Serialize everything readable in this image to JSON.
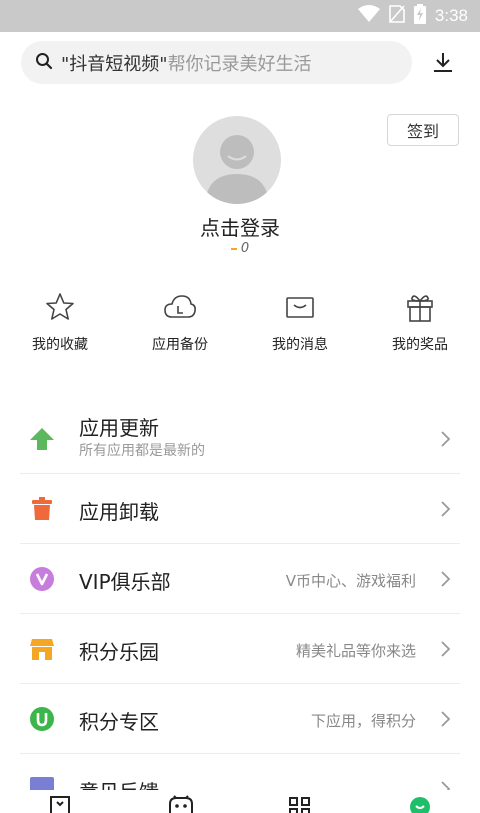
{
  "status_bar": {
    "time": "3:38",
    "icons": [
      "wifi-icon",
      "no-sim-icon",
      "battery-charging-icon"
    ]
  },
  "search": {
    "keyword": "\"抖音短视频\"",
    "hint": "帮你记录美好生活",
    "icon": "search-icon"
  },
  "header": {
    "download_icon": "download-icon",
    "signin_label": "签到"
  },
  "profile": {
    "login_label": "点击登录",
    "coin_value": "0",
    "avatar_icon": "default-avatar-icon"
  },
  "quick_actions": [
    {
      "label": "我的收藏",
      "icon": "star-icon"
    },
    {
      "label": "应用备份",
      "icon": "cloud-backup-icon"
    },
    {
      "label": "我的消息",
      "icon": "message-envelope-icon"
    },
    {
      "label": "我的奖品",
      "icon": "gift-icon"
    }
  ],
  "menu": [
    {
      "title": "应用更新",
      "subtitle": "所有应用都是最新的",
      "right": "",
      "icon": "update-arrow-icon",
      "color": "#5cb85c"
    },
    {
      "title": "应用卸载",
      "subtitle": "",
      "right": "",
      "icon": "trash-icon",
      "color": "#f0693b"
    },
    {
      "title": "VIP俱乐部",
      "subtitle": "",
      "right": "V币中心、游戏福利",
      "icon": "vip-icon",
      "color": "#c77ddb"
    },
    {
      "title": "积分乐园",
      "subtitle": "",
      "right": "精美礼品等你来选",
      "icon": "store-icon",
      "color": "#f5a623"
    },
    {
      "title": "积分专区",
      "subtitle": "",
      "right": "下应用，得积分",
      "icon": "points-u-icon",
      "color": "#3cb54a"
    },
    {
      "title": "意见反馈",
      "subtitle": "",
      "right": "",
      "icon": "feedback-icon",
      "color": "#7b7fd4"
    }
  ],
  "bottom_nav": [
    {
      "icon": "home-tab-icon"
    },
    {
      "icon": "game-tab-icon"
    },
    {
      "icon": "category-tab-icon"
    },
    {
      "icon": "mine-tab-icon",
      "active_color": "#1fbf6a"
    }
  ]
}
